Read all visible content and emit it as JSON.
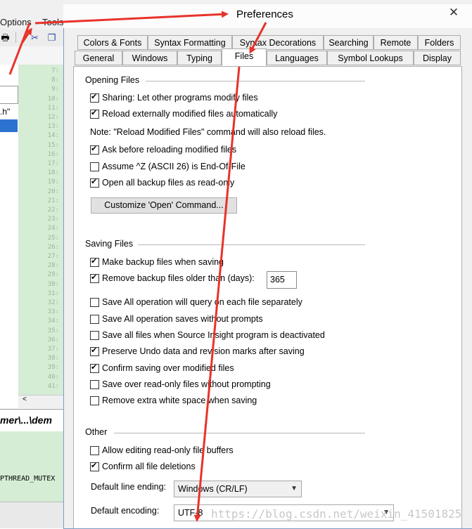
{
  "background_app": {
    "menu": [
      "Options",
      "Tools"
    ],
    "file_item": ".h\"",
    "line_numbers": [
      "7:",
      "8:",
      "9:",
      "10:",
      "11:",
      "12:",
      "13:",
      "14:",
      "15:",
      "16:",
      "17:",
      "18:",
      "19:",
      "20:",
      "21:",
      "22:",
      "23:",
      "24:",
      "25:",
      "26:",
      "27:",
      "28:",
      "29:",
      "30:",
      "31:",
      "32:",
      "33:",
      "34:",
      "35:",
      "36:",
      "37:",
      "38:",
      "39:",
      "40:",
      "41:"
    ],
    "path_text": "mer\\...\\dem",
    "bottom_text": "PTHREAD_MUTEX"
  },
  "dialog": {
    "title": "Preferences",
    "close_glyph": "✕",
    "tabs_row1": [
      "Colors & Fonts",
      "Syntax Formatting",
      "Syntax Decorations",
      "Searching",
      "Remote",
      "Folders"
    ],
    "tabs_row2": [
      "General",
      "Windows",
      "Typing",
      "Files",
      "Languages",
      "Symbol Lookups",
      "Display"
    ],
    "active_tab": "Files",
    "opening_files": {
      "title": "Opening Files",
      "options": [
        {
          "label": "Sharing: Let other programs modify files",
          "checked": true
        },
        {
          "label": "Reload externally modified files automatically",
          "checked": true
        }
      ],
      "note": "Note: \"Reload Modified Files\" command will also reload files.",
      "options2": [
        {
          "label": "Ask before reloading modified files",
          "checked": true
        },
        {
          "label": "Assume ^Z (ASCII 26) is End-Of-File",
          "checked": false
        },
        {
          "label": "Open all backup files as read-only",
          "checked": true
        }
      ],
      "customize_button": "Customize 'Open' Command..."
    },
    "saving_files": {
      "title": "Saving Files",
      "make_backup": {
        "label": "Make backup files when saving",
        "checked": true
      },
      "remove_backup": {
        "label": "Remove backup files older than (days):",
        "checked": true
      },
      "days_value": "365",
      "options": [
        {
          "label": "Save All operation will query on each file separately",
          "checked": false
        },
        {
          "label": "Save All operation saves without prompts",
          "checked": false
        },
        {
          "label": "Save all files when Source Insight program is deactivated",
          "checked": false
        },
        {
          "label": "Preserve Undo data and revision marks after saving",
          "checked": true
        },
        {
          "label": "Confirm saving over modified files",
          "checked": true
        },
        {
          "label": "Save over read-only files without prompting",
          "checked": false
        },
        {
          "label": "Remove extra white space when saving",
          "checked": false
        }
      ]
    },
    "other": {
      "title": "Other",
      "options": [
        {
          "label": "Allow editing read-only file buffers",
          "checked": false
        },
        {
          "label": "Confirm all file deletions",
          "checked": true
        }
      ],
      "line_ending_label": "Default line ending:",
      "line_ending_value": "Windows (CR/LF)",
      "encoding_label": "Default encoding:",
      "encoding_value": "UTF-8"
    }
  },
  "watermark": "https://blog.csdn.net/weixin_41501825",
  "annotation_color": "#e8332a"
}
